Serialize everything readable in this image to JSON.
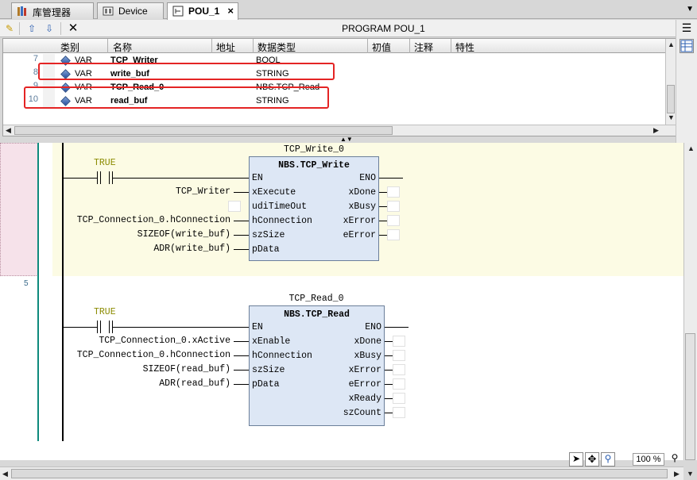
{
  "tabs": [
    {
      "label": "库管理器",
      "icon": "library-manager-icon"
    },
    {
      "label": "Device",
      "icon": "device-icon"
    },
    {
      "label": "POU_1",
      "icon": "pou-icon",
      "active": true
    }
  ],
  "toolbar": {
    "program_title": "PROGRAM POU_1"
  },
  "var_table": {
    "headers": [
      "类别",
      "名称",
      "地址",
      "数据类型",
      "初值",
      "注释",
      "特性"
    ],
    "rows": [
      {
        "num": "7",
        "scope": "VAR",
        "name": "TCP_Writer",
        "type": "BOOL",
        "highlighted": false
      },
      {
        "num": "8",
        "scope": "VAR",
        "name": "write_buf",
        "type": "STRING",
        "highlighted": true
      },
      {
        "num": "9",
        "scope": "VAR",
        "name": "TCP_Read_0",
        "type": "NBS.TCP_Read",
        "highlighted": false
      },
      {
        "num": "10",
        "scope": "VAR",
        "name": "read_buf",
        "type": "STRING",
        "highlighted": true
      }
    ]
  },
  "ladder": {
    "rung2_number": "5",
    "block1": {
      "instance": "TCP_Write_0",
      "type": "NBS.TCP_Write",
      "contact_label": "TRUE",
      "en": "EN",
      "eno": "ENO",
      "inputs": [
        "xExecute",
        "udiTimeOut",
        "hConnection",
        "szSize",
        "pData"
      ],
      "outputs": [
        "xDone",
        "xBusy",
        "xError",
        "eError"
      ],
      "input_args": [
        "TCP_Writer",
        "",
        "TCP_Connection_0.hConnection",
        "SIZEOF(write_buf)",
        "ADR(write_buf)"
      ]
    },
    "block2": {
      "instance": "TCP_Read_0",
      "type": "NBS.TCP_Read",
      "contact_label": "TRUE",
      "en": "EN",
      "eno": "ENO",
      "inputs": [
        "xEnable",
        "hConnection",
        "szSize",
        "pData"
      ],
      "outputs": [
        "xDone",
        "xBusy",
        "xError",
        "eError",
        "xReady",
        "szCount"
      ],
      "input_args": [
        "TCP_Connection_0.xActive",
        "TCP_Connection_0.hConnection",
        "SIZEOF(read_buf)",
        "ADR(read_buf)"
      ]
    }
  },
  "status": {
    "zoom": "100 %"
  }
}
